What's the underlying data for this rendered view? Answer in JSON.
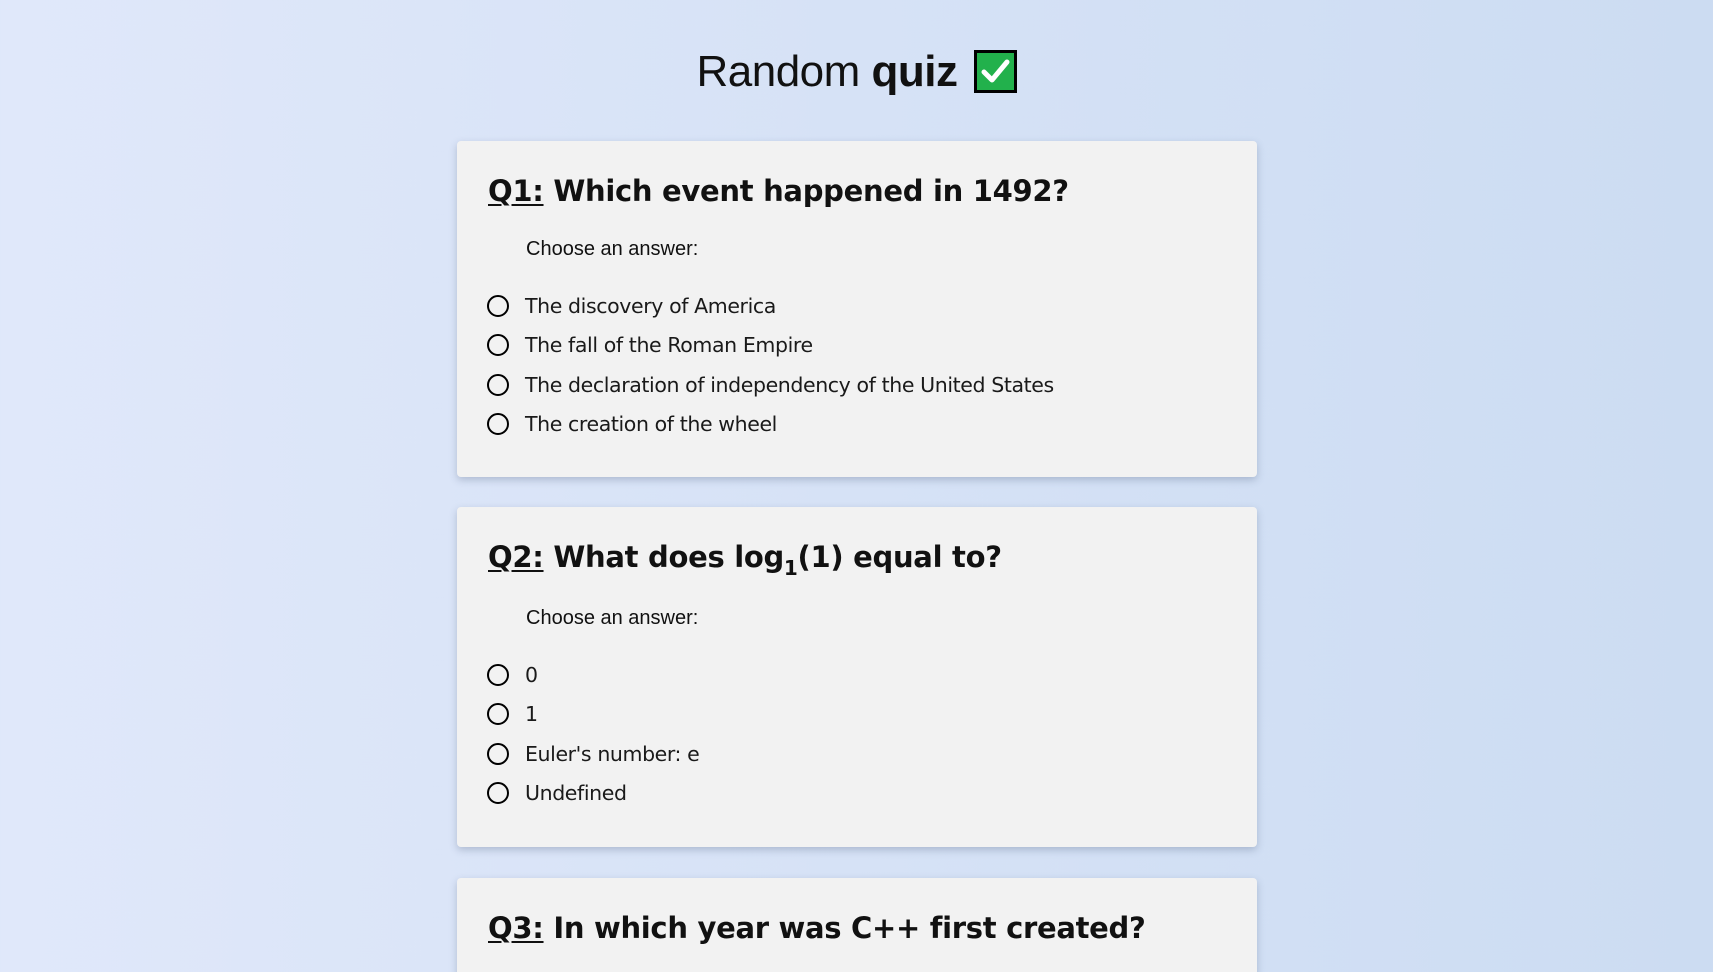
{
  "header": {
    "title_regular": "Random",
    "title_bold": "quiz",
    "title_icon": "check-mark-button-icon",
    "accent_color": "#22b14c"
  },
  "questions": [
    {
      "number": "Q1:",
      "text": "Which event happened in 1492?",
      "prompt": "Choose an answer:",
      "options": [
        "The discovery of America",
        "The fall of the Roman Empire",
        "The declaration of independency of the United States",
        "The creation of the wheel"
      ]
    },
    {
      "number": "Q2:",
      "text_before": "What does log",
      "text_subscript": "1",
      "text_after": "(1) equal to?",
      "prompt": "Choose an answer:",
      "options": [
        "0",
        "1",
        "Euler's number: e",
        "Undefined"
      ]
    },
    {
      "number": "Q3:",
      "text": "In which year was C++ first created?"
    }
  ]
}
